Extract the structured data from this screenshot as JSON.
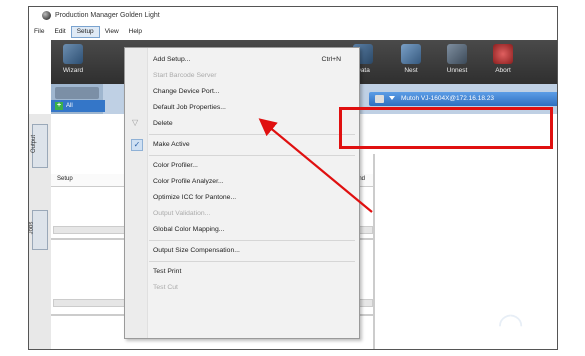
{
  "window": {
    "title": "Production Manager Golden Light"
  },
  "menubar": {
    "items": [
      "File",
      "Edit",
      "Setup",
      "View",
      "Help"
    ]
  },
  "toolbar": {
    "wizard": "Wizard",
    "data": "Data",
    "nest": "Nest",
    "unnest": "Unnest",
    "abort": "Abort"
  },
  "tabs": {
    "all": "All",
    "device": "Mutoh VJ-1604X@172.16.18.23"
  },
  "grid": {
    "setup_col": "Setup",
    "send_col": "Send"
  },
  "sidebar": {
    "output": "Output",
    "jobs": "Jobs"
  },
  "setup_menu": {
    "add_setup": "Add Setup...",
    "add_setup_shortcut": "Ctrl+N",
    "start_barcode_server": "Start Barcode Server",
    "change_device_port": "Change Device Port...",
    "default_job_properties": "Default Job Properties...",
    "delete": "Delete",
    "make_active": "Make Active",
    "color_profiler": "Color Profiler...",
    "color_profile_analyzer": "Color Profile Analyzer...",
    "optimize_icc": "Optimize ICC for Pantone...",
    "output_validation": "Output Validation...",
    "global_color_mapping": "Global Color Mapping...",
    "output_size_compensation": "Output Size Compensation...",
    "test_print": "Test Print",
    "test_cut": "Test Cut"
  },
  "colors": {
    "highlight": "#e01010",
    "arrow": "#e01010",
    "toolbar": "#3a3a3a",
    "tab_active": "#3476c8"
  }
}
